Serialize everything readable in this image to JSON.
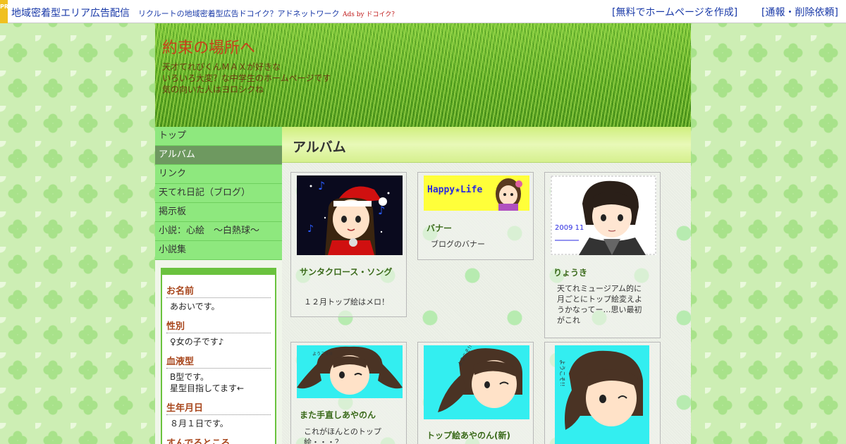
{
  "prbar": {
    "badge": "PR",
    "title": "地域密着型エリア広告配信",
    "description": "リクルートの地域密着型広告ドコイク？アドネットワーク",
    "ads_by": "Ads by ドコイク？",
    "link_create": "[無料でホームページを作成]",
    "link_report": "[通報・削除依頼]"
  },
  "header": {
    "site_title": "約束の場所へ",
    "desc_line1": "天才てれびくんＭＡＸが好きな",
    "desc_line2": "いろいろ大変？な中学生のホームページです",
    "desc_line3": "気の向いた人はヨロシクね"
  },
  "menu": {
    "items": [
      {
        "label": "トップ"
      },
      {
        "label": "アルバム"
      },
      {
        "label": "リンク"
      },
      {
        "label": "天てれ日記（ブログ）"
      },
      {
        "label": "掲示板"
      },
      {
        "label": "小説：心絵　～白熱球～"
      },
      {
        "label": "小説集"
      }
    ],
    "active_index": 1
  },
  "profile": {
    "fields": [
      {
        "label": "お名前",
        "value_line1": "あおいです。",
        "value_line2": ""
      },
      {
        "label": "性別",
        "value_line1": "♀女の子です♪",
        "value_line2": ""
      },
      {
        "label": "血液型",
        "value_line1": "B型です。",
        "value_line2": "星型目指してます←"
      },
      {
        "label": "生年月日",
        "value_line1": "８月１日です。",
        "value_line2": ""
      },
      {
        "label": "すんでるところ",
        "value_line1": "",
        "value_line2": ""
      }
    ]
  },
  "content": {
    "title": "アルバム",
    "cards": [
      {
        "title": "サンタクロース・ソング",
        "desc": "１２月トップ絵はメロ！",
        "thumb_text": ""
      },
      {
        "title": "バナー",
        "desc": "ブログのバナー",
        "thumb_text": "Happy★Life"
      },
      {
        "title": "りょうき",
        "desc": "天てれミュージアム的に月ごとにトップ絵変えようかなってー…思い最初がこれ",
        "thumb_text": "2009 11"
      },
      {
        "title": "また手直しあやのん",
        "desc": "これがほんとのトップ絵・・・？",
        "thumb_text": "ようこそ!!"
      },
      {
        "title": "トップ絵あやのん(新)",
        "desc": "",
        "thumb_text": "ようこそ!!"
      },
      {
        "title": "",
        "desc": "",
        "thumb_text": "ようこそ!!"
      }
    ]
  },
  "colors": {
    "link_blue": "#1a3aa8",
    "title_orange": "#c8431c",
    "menu_green": "#8ee87e",
    "menu_active": "#6e9960"
  }
}
